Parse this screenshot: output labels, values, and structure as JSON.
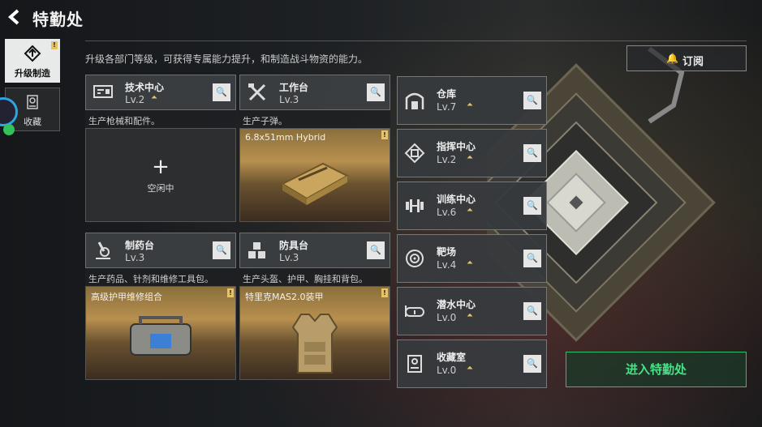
{
  "header": {
    "title": "特勤处",
    "back_icon": "back-arrow-icon"
  },
  "tabs": [
    {
      "label": "升级制造",
      "icon": "upgrade-icon",
      "active": true,
      "badge": "!"
    },
    {
      "label": "收藏",
      "icon": "collection-icon",
      "active": false
    }
  ],
  "subtitle": "升级各部门等级，可获得专属能力提升，和制造战斗物资的能力。",
  "workshops": [
    {
      "name": "技术中心",
      "level": "Lv.2",
      "desc": "生产枪械和配件。",
      "slot": {
        "type": "idle",
        "label": "空闲中"
      }
    },
    {
      "name": "工作台",
      "level": "Lv.3",
      "desc": "生产子弹。",
      "slot": {
        "type": "item",
        "label": "6.8x51mm Hybrid",
        "badge": "!"
      }
    },
    {
      "name": "制药台",
      "level": "Lv.3",
      "desc": "生产药品、针剂和维修工具包。",
      "slot": {
        "type": "item",
        "label": "高级护甲维修组合",
        "badge": "!"
      }
    },
    {
      "name": "防具台",
      "level": "Lv.3",
      "desc": "生产头盔、护甲、胸挂和背包。",
      "slot": {
        "type": "item",
        "label": "特里克MAS2.0装甲",
        "badge": "!"
      }
    }
  ],
  "facilities": [
    {
      "name": "仓库",
      "level": "Lv.7"
    },
    {
      "name": "指挥中心",
      "level": "Lv.2"
    },
    {
      "name": "训练中心",
      "level": "Lv.6"
    },
    {
      "name": "靶场",
      "level": "Lv.4"
    },
    {
      "name": "潜水中心",
      "level": "Lv.0"
    },
    {
      "name": "收藏室",
      "level": "Lv.0"
    }
  ],
  "subscribe": {
    "label": "订阅",
    "icon": "bell-icon"
  },
  "enter_button": {
    "label": "进入特勤处"
  },
  "colors": {
    "accent_gold": "#e6c36a",
    "accent_green": "#48e086",
    "card_bg": "#3c3f42"
  }
}
